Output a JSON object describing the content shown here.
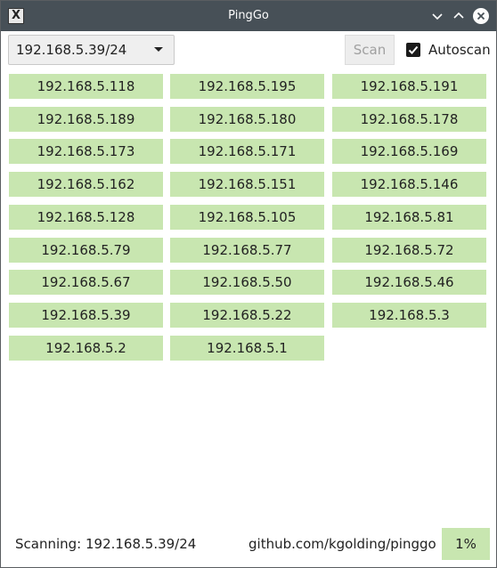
{
  "window": {
    "title": "PingGo"
  },
  "toolbar": {
    "subnet_value": "192.168.5.39/24",
    "scan_label": "Scan",
    "autoscan_label": "Autoscan",
    "autoscan_checked": true
  },
  "hosts": [
    "192.168.5.118",
    "192.168.5.195",
    "192.168.5.191",
    "192.168.5.189",
    "192.168.5.180",
    "192.168.5.178",
    "192.168.5.173",
    "192.168.5.171",
    "192.168.5.169",
    "192.168.5.162",
    "192.168.5.151",
    "192.168.5.146",
    "192.168.5.128",
    "192.168.5.105",
    "192.168.5.81",
    "192.168.5.79",
    "192.168.5.77",
    "192.168.5.72",
    "192.168.5.67",
    "192.168.5.50",
    "192.168.5.46",
    "192.168.5.39",
    "192.168.5.22",
    "192.168.5.3",
    "192.168.5.2",
    "192.168.5.1"
  ],
  "status": {
    "scanning_text": "Scanning: 192.168.5.39/24",
    "link_text": "github.com/kgolding/pinggo",
    "progress_text": "1%",
    "progress_fraction": 0.01
  },
  "colors": {
    "host_up": "#c8e6b0",
    "titlebar": "#475057"
  }
}
